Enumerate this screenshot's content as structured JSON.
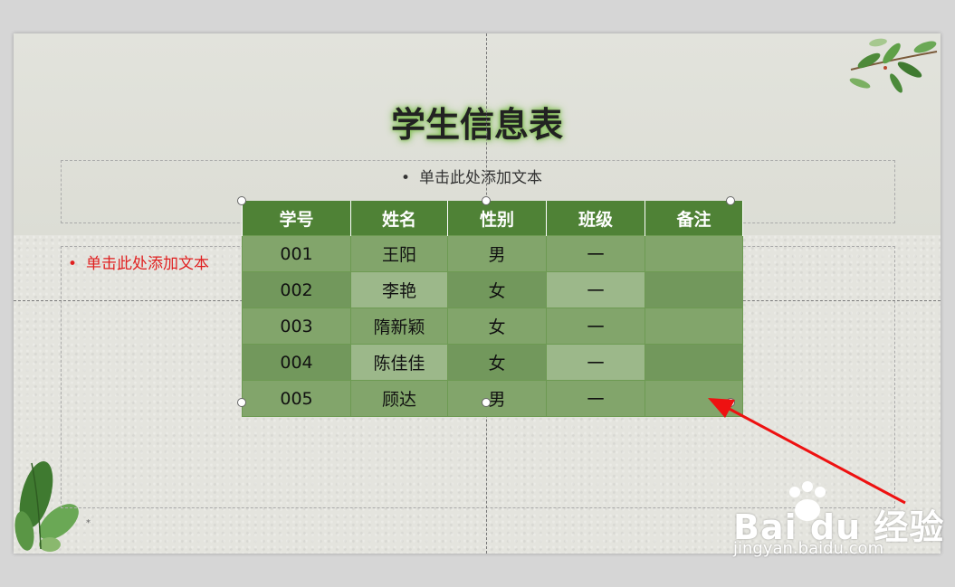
{
  "slide": {
    "title": "学生信息表",
    "subtitle_placeholder": "单击此处添加文本",
    "body_placeholder": "单击此处添加文本",
    "bullet": "•",
    "star": "*"
  },
  "table": {
    "headers": [
      "学号",
      "姓名",
      "性别",
      "班级",
      "备注"
    ],
    "rows": [
      [
        "001",
        "王阳",
        "男",
        "一",
        ""
      ],
      [
        "002",
        "李艳",
        "女",
        "一",
        ""
      ],
      [
        "003",
        "隋新颖",
        "女",
        "一",
        ""
      ],
      [
        "004",
        "陈佳佳",
        "女",
        "一",
        ""
      ],
      [
        "005",
        "顾达",
        "男",
        "一",
        ""
      ]
    ]
  },
  "watermark": {
    "logo": "Bai du 经验",
    "url": "jingyan.baidu.com"
  },
  "colors": {
    "header_green": "#4f8236",
    "cell_green": "#82a56b",
    "arrow_red": "#ee1111",
    "body_text_red": "#e02020"
  },
  "icons": [
    "leaf-decoration-icon",
    "paw-logo-icon",
    "resize-handle-icon",
    "red-arrow-icon"
  ]
}
